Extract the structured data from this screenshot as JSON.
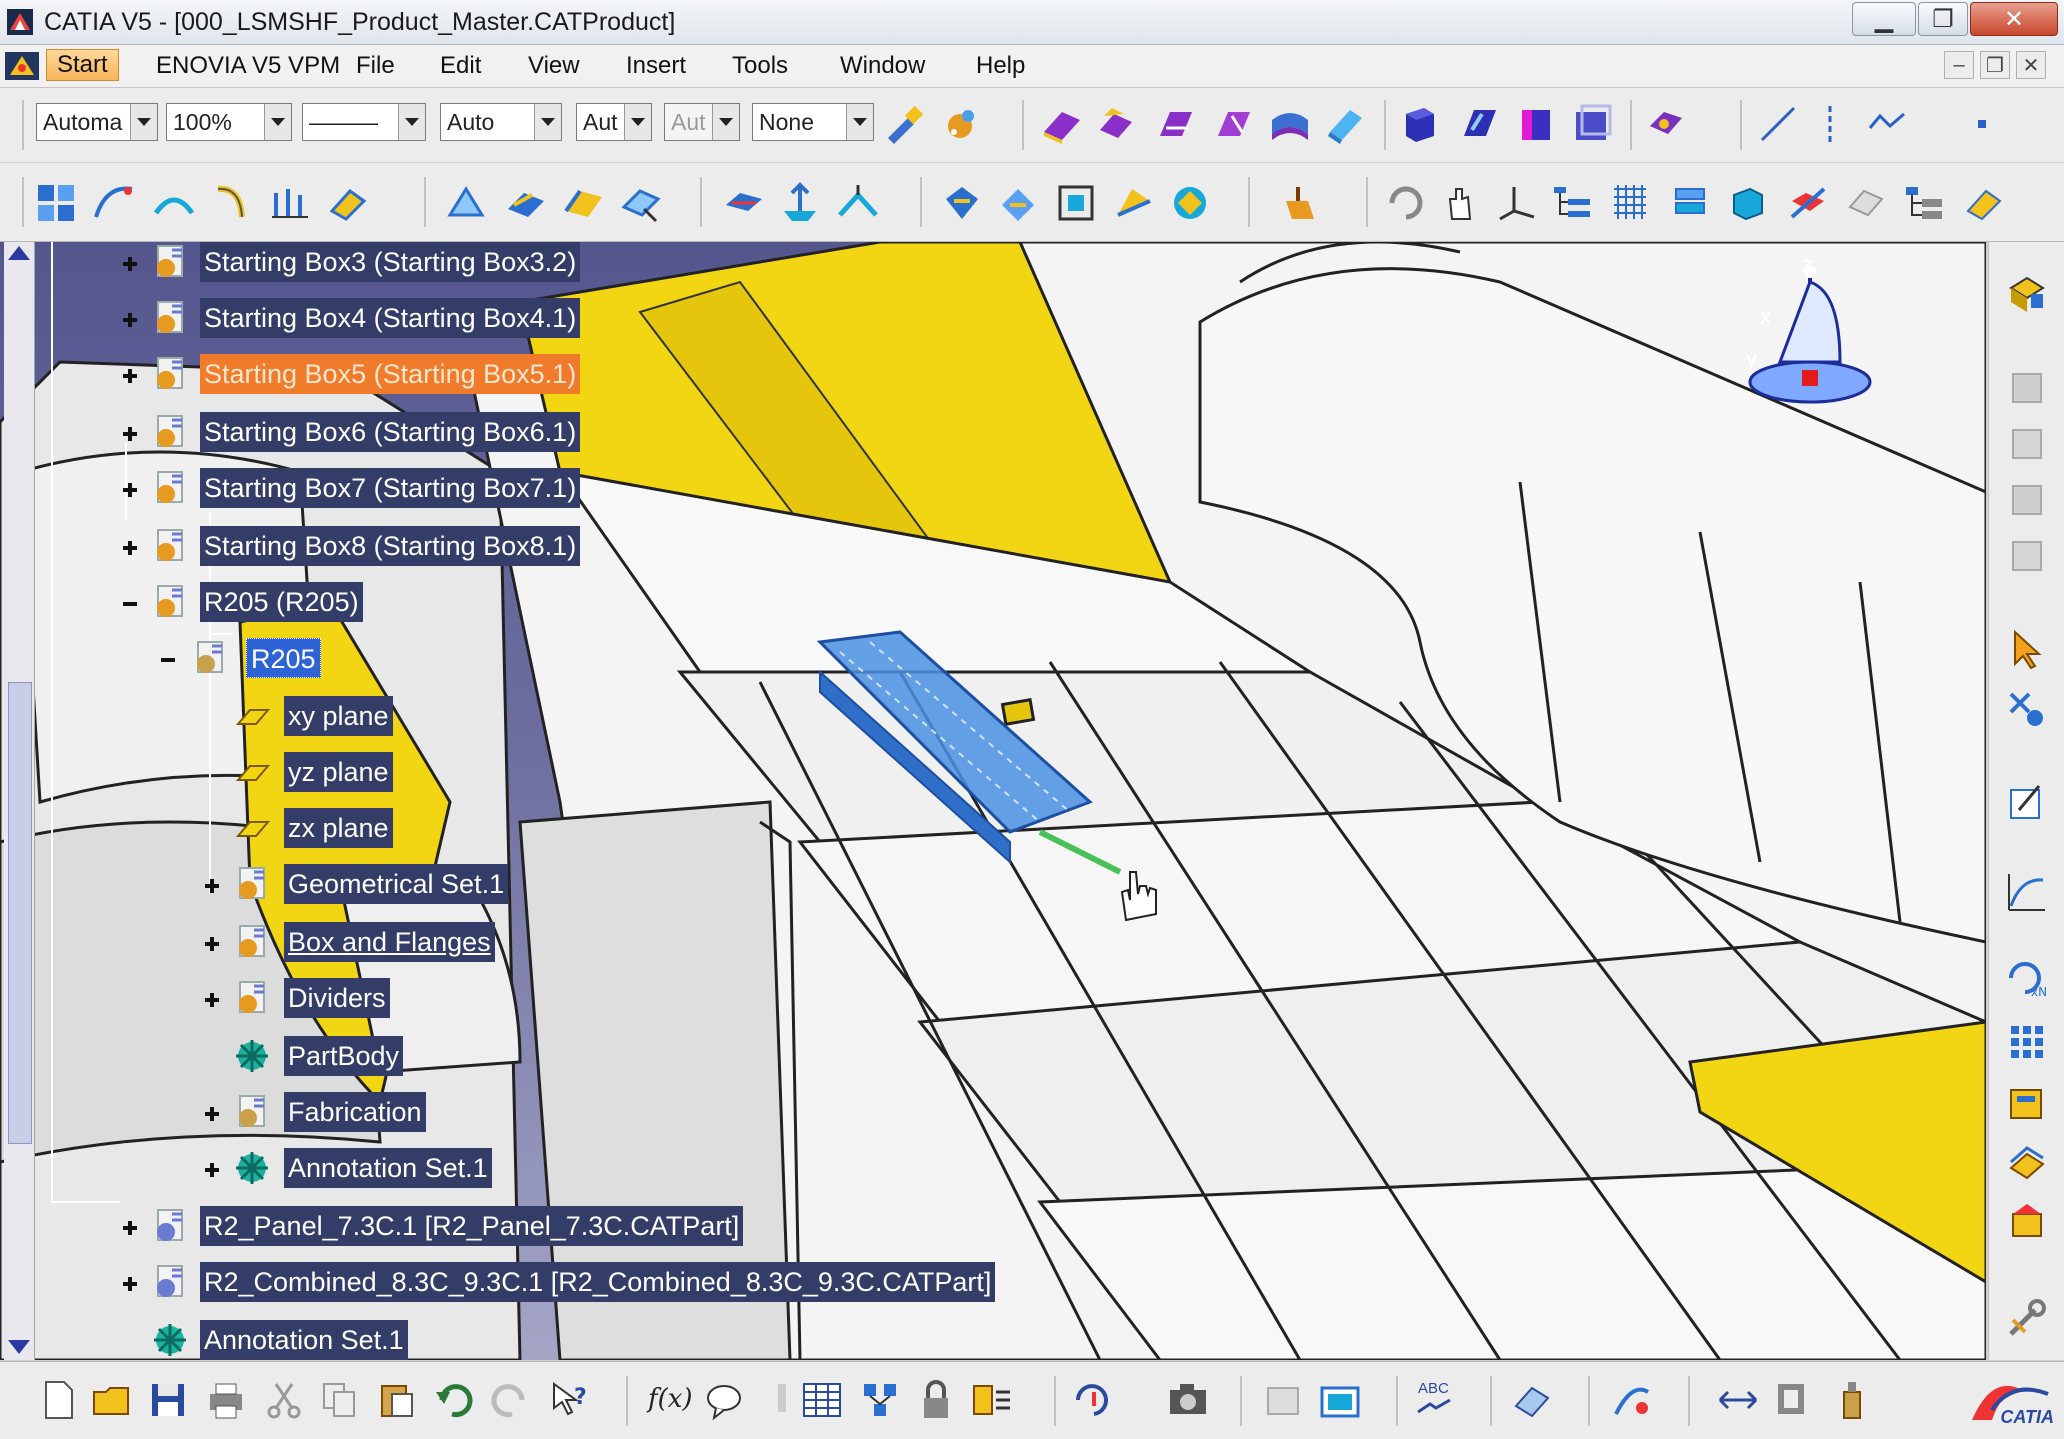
{
  "window": {
    "title": "CATIA V5 - [000_LSMSHF_Product_Master.CATProduct]",
    "minimize_glyph": "▁",
    "restore_glyph": "❐",
    "close_glyph": "✕"
  },
  "menubar": {
    "items": [
      "Start",
      "ENOVIA V5 VPM",
      "File",
      "Edit",
      "View",
      "Insert",
      "Tools",
      "Window",
      "Help"
    ],
    "mdi_controls": [
      "–",
      "❐",
      "✕"
    ]
  },
  "toolbar": {
    "combos": [
      {
        "value": "Automa",
        "disabled": false
      },
      {
        "value": "100%",
        "disabled": false
      },
      {
        "value": "———",
        "disabled": false
      },
      {
        "value": "Auto",
        "disabled": false
      },
      {
        "value": "Aut",
        "disabled": false
      },
      {
        "value": "Aut",
        "disabled": true
      },
      {
        "value": "None",
        "disabled": false
      }
    ]
  },
  "compass": {
    "z": "z",
    "x": "x",
    "y": "y"
  },
  "tree": {
    "nodes": [
      {
        "label": "Starting Box3 (Starting Box3.2)",
        "state": "normal"
      },
      {
        "label": "Starting Box4 (Starting Box4.1)",
        "state": "normal"
      },
      {
        "label": "Starting Box5 (Starting Box5.1)",
        "state": "selected"
      },
      {
        "label": "Starting Box6 (Starting Box6.1)",
        "state": "normal"
      },
      {
        "label": "Starting Box7 (Starting Box7.1)",
        "state": "normal"
      },
      {
        "label": "Starting Box8 (Starting Box8.1)",
        "state": "normal"
      },
      {
        "label": "R205 (R205)",
        "state": "normal"
      },
      {
        "label": "R205",
        "state": "current"
      },
      {
        "label": "xy plane",
        "state": "normal"
      },
      {
        "label": "yz plane",
        "state": "normal"
      },
      {
        "label": "zx plane",
        "state": "normal"
      },
      {
        "label": "Geometrical Set.1",
        "state": "normal"
      },
      {
        "label": "Box and Flanges",
        "state": "underline"
      },
      {
        "label": "Dividers",
        "state": "normal"
      },
      {
        "label": "PartBody",
        "state": "normal"
      },
      {
        "label": "Fabrication",
        "state": "normal"
      },
      {
        "label": "Annotation Set.1",
        "state": "normal"
      },
      {
        "label": "R2_Panel_7.3C.1 [R2_Panel_7.3C.CATPart]",
        "state": "normal"
      },
      {
        "label": "R2_Combined_8.3C_9.3C.1 [R2_Combined_8.3C_9.3C.CATPart]",
        "state": "normal"
      },
      {
        "label": "Annotation Set.1",
        "state": "normal"
      }
    ]
  },
  "bottom_toolbar": {
    "fx_label": "f(x)",
    "abc_label": "ABC"
  },
  "brand": {
    "logo_text": "CATIA"
  },
  "colors": {
    "viewport_bg_top": "#55568e",
    "tree_node_bg": "#333d68",
    "selected_bg": "#f07b2b",
    "current_bg": "#2e63d6",
    "surface_yellow": "#f2d513",
    "highlight_blue": "#4a90e2"
  }
}
